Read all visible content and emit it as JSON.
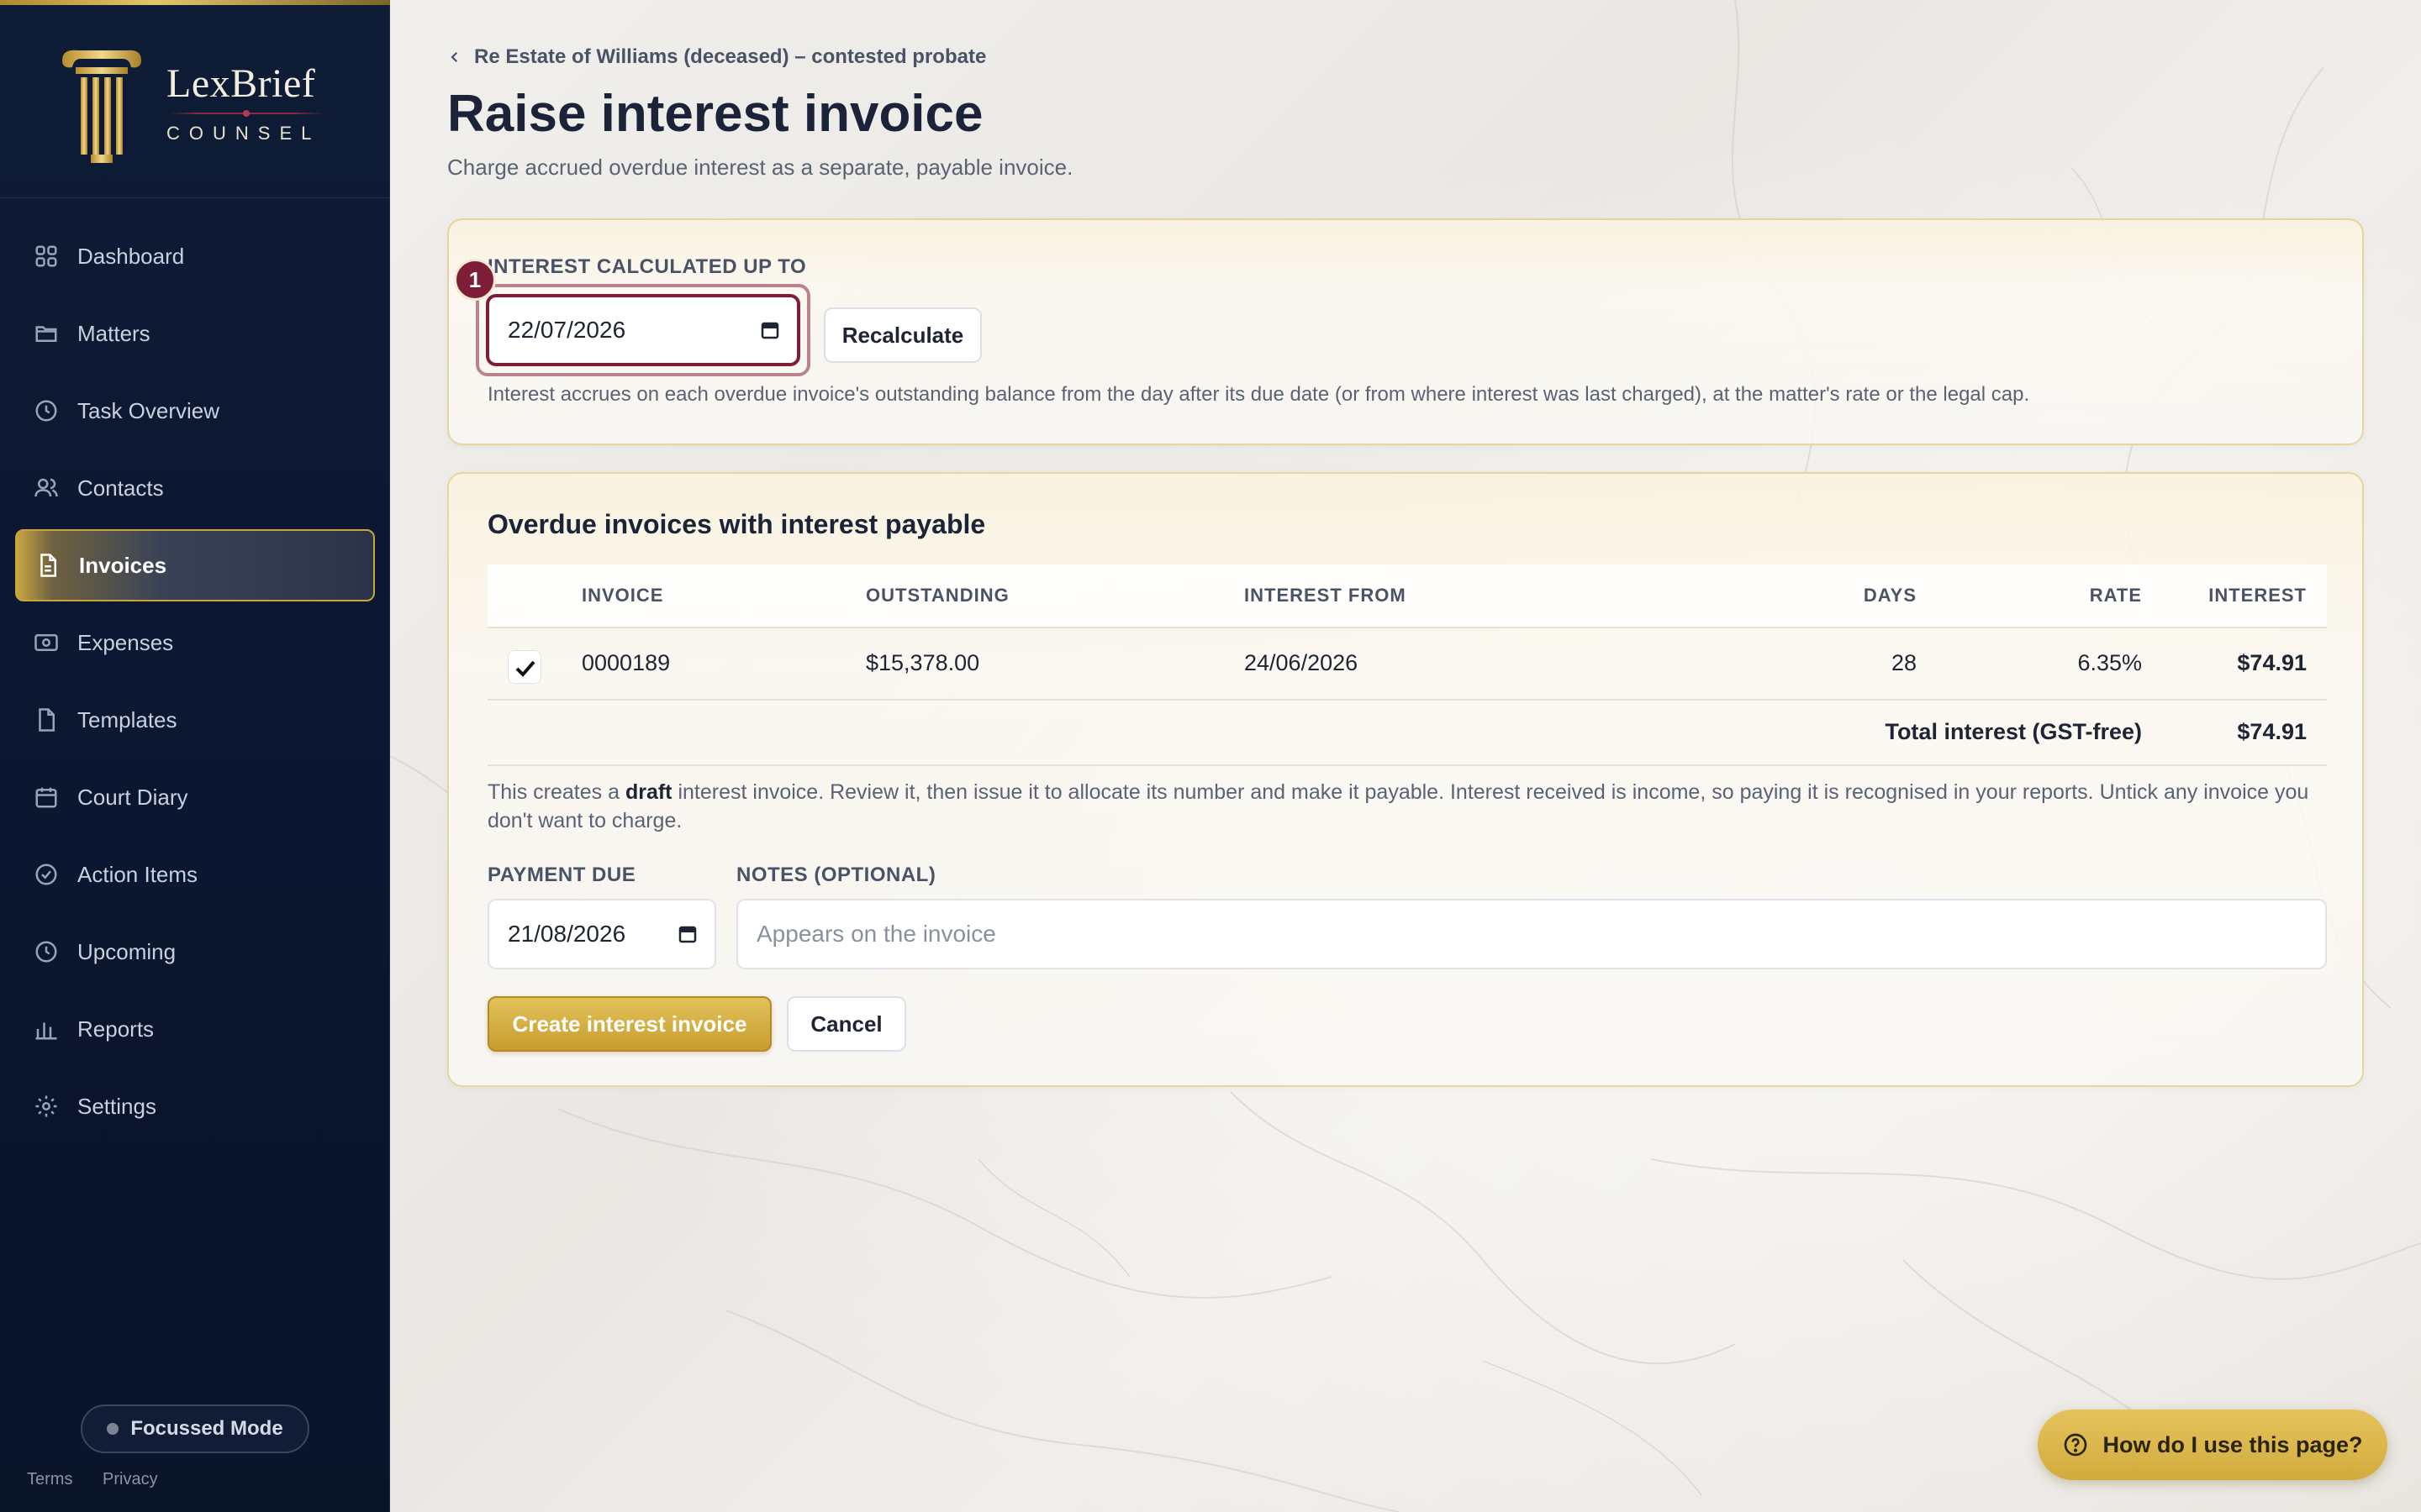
{
  "brand": {
    "name": "LexBrief",
    "tagline": "COUNSEL"
  },
  "sidebar": {
    "items": [
      {
        "label": "Dashboard",
        "icon": "grid-icon"
      },
      {
        "label": "Matters",
        "icon": "folder-icon"
      },
      {
        "label": "Task Overview",
        "icon": "clock-icon"
      },
      {
        "label": "Contacts",
        "icon": "users-icon"
      },
      {
        "label": "Invoices",
        "icon": "file-text-icon",
        "active": true
      },
      {
        "label": "Expenses",
        "icon": "banknote-icon"
      },
      {
        "label": "Templates",
        "icon": "file-icon"
      },
      {
        "label": "Court Diary",
        "icon": "calendar-icon"
      },
      {
        "label": "Action Items",
        "icon": "check-circle-icon"
      },
      {
        "label": "Upcoming",
        "icon": "clock-icon"
      },
      {
        "label": "Reports",
        "icon": "bar-chart-icon"
      },
      {
        "label": "Settings",
        "icon": "gear-icon"
      }
    ],
    "focus_mode": "Focussed Mode",
    "terms": "Terms",
    "privacy": "Privacy"
  },
  "header": {
    "breadcrumb": "Re Estate of Williams (deceased) – contested probate",
    "title": "Raise interest invoice",
    "subtitle": "Charge accrued overdue interest as a separate, payable invoice."
  },
  "calc": {
    "label": "INTEREST CALCULATED UP TO",
    "date": "22/07/2026",
    "step": "1",
    "recalculate": "Recalculate",
    "hint": "Interest accrues on each overdue invoice's outstanding balance from the day after its due date (or from where interest was last charged), at the matter's rate or the legal cap."
  },
  "overdue": {
    "title": "Overdue invoices with interest payable",
    "columns": {
      "invoice": "INVOICE",
      "outstanding": "OUTSTANDING",
      "interest_from": "INTEREST FROM",
      "days": "DAYS",
      "rate": "RATE",
      "interest": "INTEREST"
    },
    "rows": [
      {
        "checked": true,
        "invoice": "0000189",
        "outstanding": "$15,378.00",
        "interest_from": "24/06/2026",
        "days": "28",
        "rate": "6.35%",
        "interest": "$74.91"
      }
    ],
    "total_label": "Total interest (GST-free)",
    "total_value": "$74.91",
    "note_prefix": "This creates a ",
    "note_bold": "draft",
    "note_suffix": " interest invoice. Review it, then issue it to allocate its number and make it payable. Interest received is income, so paying it is recognised in your reports. Untick any invoice you don't want to charge.",
    "payment_due_label": "PAYMENT DUE",
    "payment_due": "21/08/2026",
    "notes_label": "NOTES (OPTIONAL)",
    "notes_placeholder": "Appears on the invoice",
    "create": "Create interest invoice",
    "cancel": "Cancel"
  },
  "help": {
    "label": "How do I use this page?"
  },
  "colors": {
    "accent_gold": "#c99d2f",
    "focus_maroon": "#7d1d38",
    "sidebar_navy": "#0f1c36"
  }
}
